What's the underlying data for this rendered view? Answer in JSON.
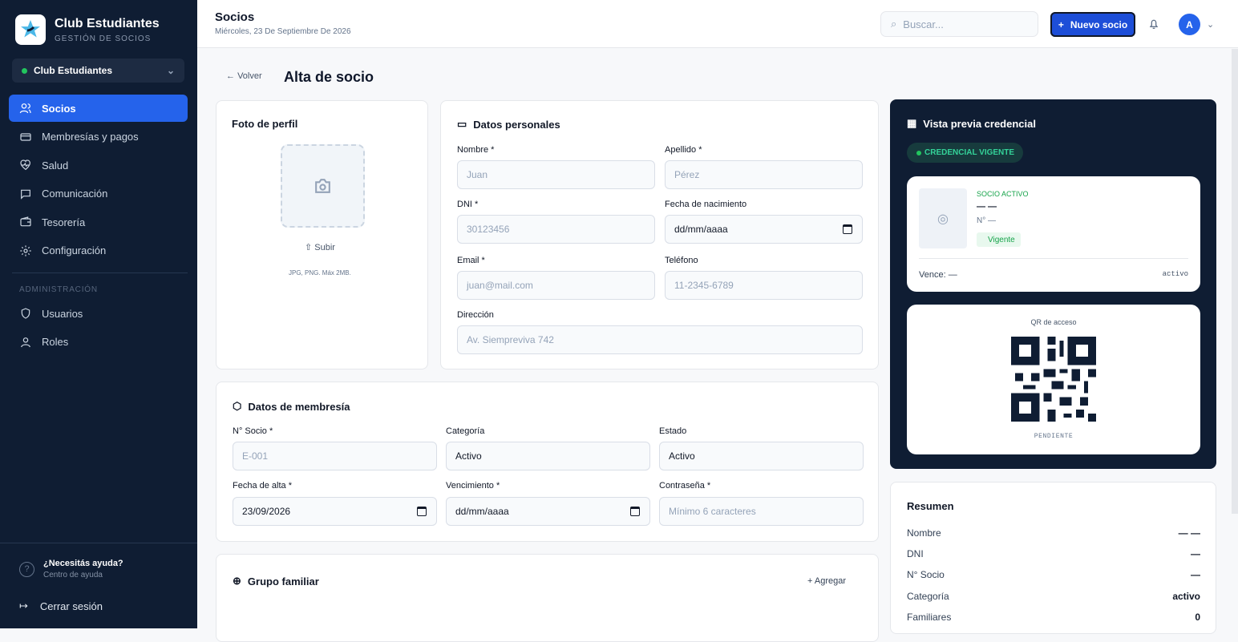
{
  "app": {
    "title": "Club Estudiantes",
    "subtitle": "GESTIÓN DE SOCIOS",
    "club": "Club Estudiantes"
  },
  "nav": [
    {
      "label": "Socios"
    },
    {
      "label": "Membresías y pagos"
    },
    {
      "label": "Salud"
    },
    {
      "label": "Comunicación"
    },
    {
      "label": "Tesorería"
    },
    {
      "label": "Configuración"
    }
  ],
  "admin": {
    "title": "ADMINISTRACIÓN",
    "items": [
      {
        "label": "Usuarios"
      },
      {
        "label": "Roles"
      }
    ]
  },
  "help": {
    "title": "¿Necesitás ayuda?",
    "sub": "Centro de ayuda",
    "logout": "Cerrar sesión"
  },
  "header": {
    "title": "Socios",
    "date": "Miércoles, 23 De Septiembre De 2026",
    "search": "Buscar...",
    "new": "Nuevo socio",
    "avatar": "A"
  },
  "page": {
    "back": "Volver",
    "title": "Alta de socio"
  },
  "photo": {
    "title": "Foto de perfil",
    "upload": "Subir",
    "format": "JPG, PNG. Máx 2MB."
  },
  "personal": {
    "title": "Datos personales",
    "nombre": "Nombre *",
    "nombre_ph": "Juan",
    "apellido": "Apellido *",
    "apellido_ph": "Pérez",
    "dni": "DNI *",
    "dni_ph": "30123456",
    "fecha": "Fecha de nacimiento",
    "fecha_val": "dd/mm/aaaa",
    "email": "Email *",
    "email_ph": "juan@mail.com",
    "telefono": "Teléfono",
    "telefono_ph": "11-2345-6789",
    "direccion": "Dirección",
    "direccion_ph": "Av. Siempreviva 742"
  },
  "membership": {
    "title": "Datos de membresía",
    "socio": "N° Socio *",
    "socio_ph": "E-001",
    "categoria": "Categoría",
    "categoria_val": "Activo",
    "estado": "Estado",
    "estado_val": "Activo",
    "alta": "Fecha de alta *",
    "alta_val": "23/09/2026",
    "vencimiento": "Vencimiento *",
    "vencimiento_val": "dd/mm/aaaa",
    "password": "Contraseña *",
    "password_ph": "Mínimo 6 caracteres"
  },
  "family": {
    "title": "Grupo familiar",
    "add": "Agregar"
  },
  "credential": {
    "title": "Vista previa credencial",
    "status": "CREDENCIAL VIGENTE",
    "type": "SOCIO ACTIVO",
    "name": "— —",
    "number": "N° —",
    "badge": "Vigente",
    "expires": "Vence: —",
    "category": "activo",
    "qr": "QR de acceso",
    "pending": "PENDIENTE"
  },
  "summary": {
    "title": "Resumen",
    "rows": [
      {
        "label": "Nombre",
        "value": "— —"
      },
      {
        "label": "DNI",
        "value": "—"
      },
      {
        "label": "N° Socio",
        "value": "—"
      },
      {
        "label": "Categoría",
        "value": "activo"
      },
      {
        "label": "Familiares",
        "value": "0"
      }
    ]
  },
  "colors": {
    "sidebar": "#0f1d33",
    "accent": "#2563eb",
    "success": "#22c55e"
  }
}
